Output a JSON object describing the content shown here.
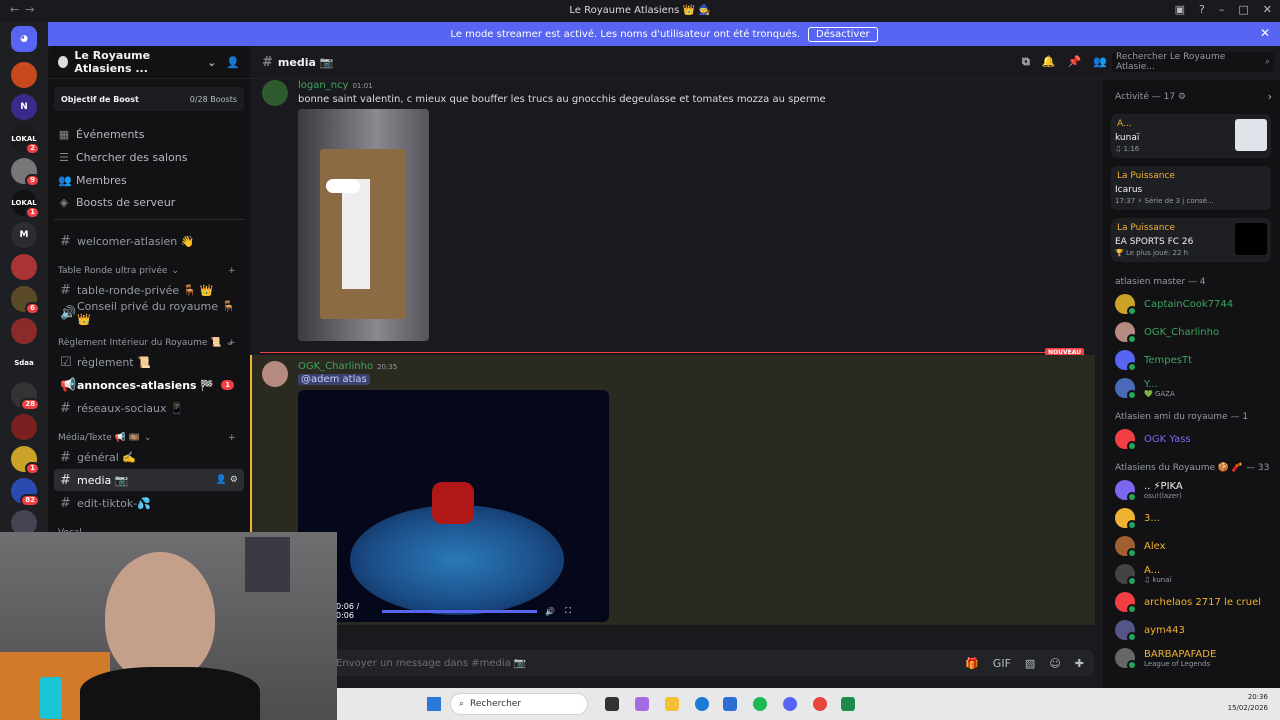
{
  "window": {
    "title": "Le Royaume Atlasiens 👑 🧙"
  },
  "banner": {
    "text": "Le mode streamer est activé. Les noms d'utilisateur ont été tronqués.",
    "button": "Désactiver"
  },
  "guilds": [
    {
      "label": "",
      "badge": "",
      "color": "#c64a1d"
    },
    {
      "label": "N",
      "badge": "",
      "color": "#3a2a8a"
    },
    {
      "label": "LOKAL",
      "badge": "2",
      "color": "#1a1a1a"
    },
    {
      "label": "",
      "badge": "9",
      "color": "#777"
    },
    {
      "label": "LOKAL",
      "badge": "1",
      "color": "#111"
    },
    {
      "label": "M",
      "badge": "",
      "color": "#2b2d31"
    },
    {
      "label": "",
      "badge": "",
      "color": "#a33"
    },
    {
      "label": "",
      "badge": "6",
      "color": "#5a4a2a"
    },
    {
      "label": "",
      "badge": "",
      "color": "#8a2a2a"
    },
    {
      "label": "Sdaa",
      "badge": "",
      "color": "#1e1f22"
    },
    {
      "label": "",
      "badge": "28",
      "color": "#333"
    },
    {
      "label": "",
      "badge": "",
      "color": "#7a2020"
    },
    {
      "label": "",
      "badge": "1",
      "color": "#c9a227"
    },
    {
      "label": "",
      "badge": "82",
      "color": "#2a4ab0"
    },
    {
      "label": "",
      "badge": "",
      "color": "#445"
    }
  ],
  "server": {
    "name": "Le Royaume Atlasiens ...",
    "boost_label": "Objectif de Boost",
    "boost_progress": "0/28 Boosts",
    "menu": [
      "Événements",
      "Chercher des salons",
      "Membres",
      "Boosts de serveur"
    ]
  },
  "channels": {
    "welcome": "welcomer-atlasien 👋",
    "cat1": "Table Ronde ultra privée",
    "c1": "table-ronde-privée 🪑 👑",
    "c2": "Conseil privé du royaume 🪑 👑",
    "cat2": "Règlement Intérieur du Royaume 📜",
    "c3": "règlement 📜",
    "c4": "annonces-atlasiens 🏁",
    "c4_badge": "1",
    "c5": "réseaux-sociaux 📱",
    "cat3": "Média/Texte 📢 🎞️",
    "c6": "général ✍️",
    "c7": "media 📷",
    "c8": "edit-tiktok-💦",
    "cat4": "Vocal"
  },
  "header": {
    "channel": "media 📷",
    "search_placeholder": "Rechercher Le Royaume Atlasie..."
  },
  "messages": [
    {
      "user": "logan_ncy",
      "time": "01:01",
      "text": "bonne saint valentin, c mieux que bouffer les trucs au gnocchis degeulasse et tomates mozza au sperme"
    },
    {
      "user": "OGK_Charlinho",
      "time": "20:35",
      "mention": "@adem atlas",
      "video_time": "0:06 / 0:06"
    }
  ],
  "new_label": "NOUVEAU",
  "composer": {
    "placeholder": "Envoyer un message dans #media 📷"
  },
  "activity": {
    "title": "Activité — 17",
    "cards": [
      {
        "line1": "A...",
        "line2": "kunaï",
        "line3": "♫ 1:16"
      },
      {
        "line1": "La Puissance",
        "line2": "Icarus",
        "line3": "17:37  ⚡ Série de 3 j consé..."
      },
      {
        "line1": "La Puissance",
        "line2": "EA SPORTS FC 26",
        "line3": "🏆 Le plus joué: 22 h"
      }
    ]
  },
  "groups": [
    {
      "title": "atlasien master — 4",
      "members": [
        {
          "name": "CaptainCook7744",
          "color": "#3ba55d",
          "sub": ""
        },
        {
          "name": "OGK_Charlinho",
          "color": "#3ba55d",
          "sub": ""
        },
        {
          "name": "TempesTt",
          "color": "#3ba55d",
          "sub": ""
        },
        {
          "name": "Y...",
          "color": "#3ba55d",
          "sub": "💚 GAZA"
        }
      ]
    },
    {
      "title": "Atlasien ami du royaume — 1",
      "members": [
        {
          "name": "OGK Yass",
          "color": "#7b68ee",
          "sub": ""
        }
      ]
    },
    {
      "title": "Atlasiens du Royaume 🍪 🧨 — 33",
      "members": [
        {
          "name": "..  ⚡PIKA",
          "color": "#f2f3f5",
          "sub": "osu!(lazer)"
        },
        {
          "name": "3...",
          "color": "#f0b232",
          "sub": ""
        },
        {
          "name": "Alex",
          "color": "#f0b232",
          "sub": ""
        },
        {
          "name": "A...",
          "color": "#f0b232",
          "sub": "♫ kunaï"
        },
        {
          "name": "archelaos 2717 le cruel",
          "color": "#f0b232",
          "sub": ""
        },
        {
          "name": "aym443",
          "color": "#f0b232",
          "sub": ""
        },
        {
          "name": "BARBAPAFADE",
          "color": "#f0b232",
          "sub": "League of Legends"
        }
      ]
    }
  ],
  "taskbar": {
    "search": "Rechercher",
    "time": "20:36",
    "date": "15/02/2026"
  }
}
